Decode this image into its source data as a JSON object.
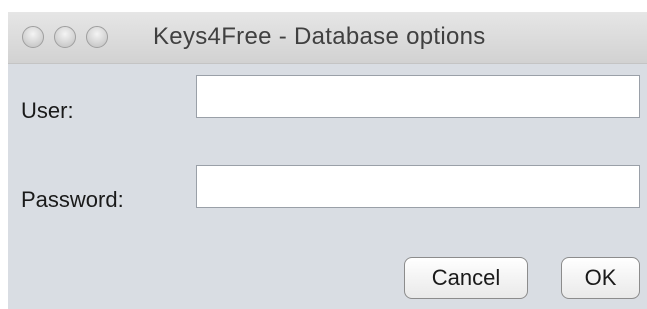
{
  "window": {
    "title": "Keys4Free - Database options"
  },
  "form": {
    "user_label": "User:",
    "user_value": "",
    "password_label": "Password:",
    "password_value": ""
  },
  "buttons": {
    "cancel_label": "Cancel",
    "ok_label": "OK"
  },
  "icons": {
    "close": "traffic-light-close-icon",
    "minimize": "traffic-light-minimize-icon",
    "zoom": "traffic-light-zoom-icon"
  },
  "colors": {
    "window_background": "#d9dde3",
    "titlebar": "#dcdcdc",
    "field_background": "#ffffff"
  }
}
